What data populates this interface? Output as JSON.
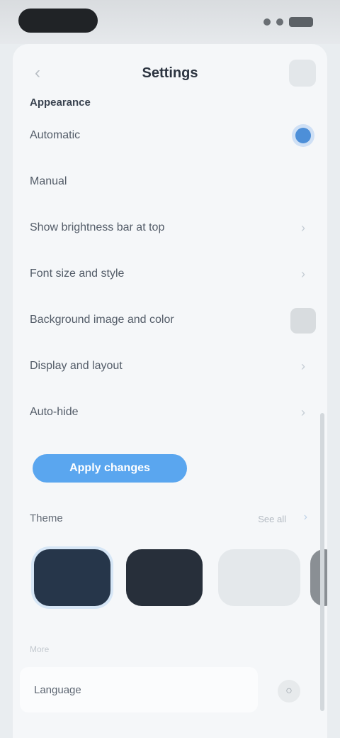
{
  "status_bar": {},
  "header": {
    "back_icon": "chevron-left-icon",
    "back_glyph": "‹",
    "title": "Settings",
    "action_icon": "menu-icon"
  },
  "section": {
    "title": "Appearance"
  },
  "settings": [
    {
      "label": "Automatic",
      "control": "radio-on"
    },
    {
      "label": "Manual",
      "control": "none"
    },
    {
      "label": "Show brightness bar at top",
      "control": "chevron"
    },
    {
      "label": "Font size and style",
      "control": "chevron"
    },
    {
      "label": "Background image and color",
      "control": "box"
    },
    {
      "label": "Display and layout",
      "control": "chevron"
    },
    {
      "label": "Auto-hide",
      "control": "chevron"
    }
  ],
  "primary_button": {
    "label": "Apply changes"
  },
  "themes": {
    "label": "Theme",
    "link": "See all",
    "arrow_glyph": "›",
    "swatches": [
      {
        "name": "Navy",
        "color": "#26364a",
        "selected": true
      },
      {
        "name": "Charcoal",
        "color": "#272f3a",
        "selected": false
      },
      {
        "name": "Light",
        "color": "#e4e8eb",
        "selected": false
      },
      {
        "name": "Gray",
        "color": "#8a8f94",
        "selected": false
      }
    ]
  },
  "footnote": "More",
  "bottom": {
    "label": "Language",
    "icon": "globe-icon",
    "icon_glyph": "○"
  },
  "colors": {
    "accent": "#5aa6ef",
    "background": "#f5f7f9"
  }
}
